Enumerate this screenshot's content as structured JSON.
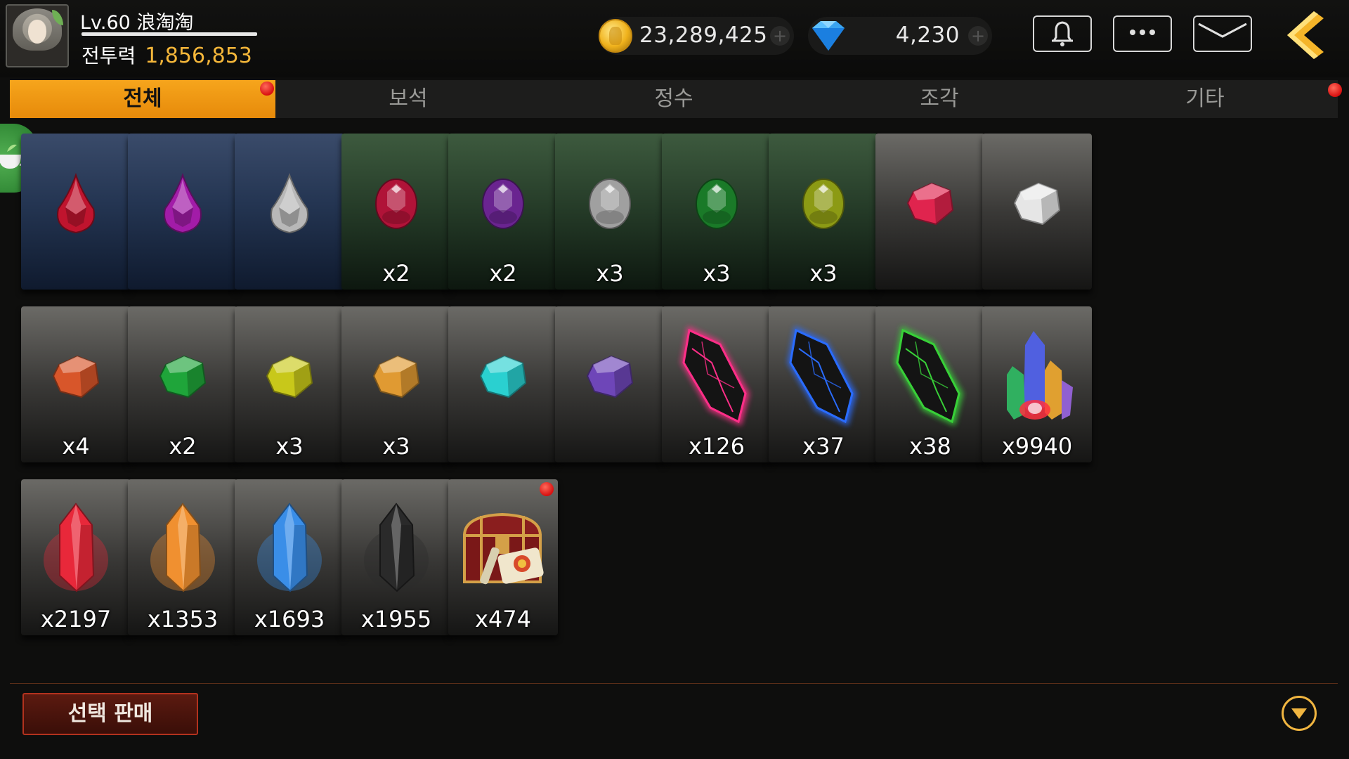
{
  "player": {
    "level_name": "Lv.60 浪淘淘",
    "power_label": "전투력",
    "power_value": "1,856,853"
  },
  "currency": {
    "gold": "23,289,425",
    "gems": "4,230"
  },
  "tabs": [
    {
      "label": "전체",
      "active": true,
      "has_badge": true
    },
    {
      "label": "보석",
      "active": false,
      "has_badge": false
    },
    {
      "label": "정수",
      "active": false,
      "has_badge": false
    },
    {
      "label": "조각",
      "active": false,
      "has_badge": false
    },
    {
      "label": "기타",
      "active": false,
      "has_badge": true
    }
  ],
  "items": [
    {
      "icon": "ruby-drop-gem-icon",
      "bg": "blue",
      "color": "#c0142e",
      "shape": "drop",
      "qty": ""
    },
    {
      "icon": "amethyst-drop-gem-icon",
      "bg": "blue",
      "color": "#a21ca8",
      "shape": "drop",
      "qty": ""
    },
    {
      "icon": "diamond-drop-gem-icon",
      "bg": "blue",
      "color": "#b8b8b8",
      "shape": "drop",
      "qty": ""
    },
    {
      "icon": "ruby-oval-gem-icon",
      "bg": "green",
      "color": "#b01338",
      "shape": "oval",
      "qty": "x2"
    },
    {
      "icon": "amethyst-oval-gem-icon",
      "bg": "green",
      "color": "#6a2490",
      "shape": "oval",
      "qty": "x2"
    },
    {
      "icon": "pearl-oval-gem-icon",
      "bg": "green",
      "color": "#a0a0a0",
      "shape": "oval",
      "qty": "x3"
    },
    {
      "icon": "emerald-oval-gem-icon",
      "bg": "green",
      "color": "#1a7a28",
      "shape": "oval",
      "qty": "x3"
    },
    {
      "icon": "peridot-oval-gem-icon",
      "bg": "green",
      "color": "#8c9a14",
      "shape": "oval",
      "qty": "x3"
    },
    {
      "icon": "pink-rough-gem-icon",
      "bg": "gray",
      "color": "#e0244e",
      "shape": "rough",
      "qty": ""
    },
    {
      "icon": "white-rough-gem-icon",
      "bg": "gray",
      "color": "#e6e6e6",
      "shape": "rough",
      "qty": ""
    },
    {
      "icon": "orange-rough-gem-icon",
      "bg": "gray",
      "color": "#d8562a",
      "shape": "rough",
      "qty": "x4"
    },
    {
      "icon": "green-rough-gem-icon",
      "bg": "gray",
      "color": "#1fa53a",
      "shape": "rough",
      "qty": "x2"
    },
    {
      "icon": "yellow-rough-gem-icon",
      "bg": "gray",
      "color": "#c8c81a",
      "shape": "rough",
      "qty": "x3"
    },
    {
      "icon": "amber-rough-gem-icon",
      "bg": "gray",
      "color": "#e09a32",
      "shape": "rough",
      "qty": "x3"
    },
    {
      "icon": "cyan-rough-gem-icon",
      "bg": "gray",
      "color": "#2ad0d0",
      "shape": "rough",
      "qty": ""
    },
    {
      "icon": "violet-rough-gem-icon",
      "bg": "gray",
      "color": "#6e46b8",
      "shape": "rough",
      "qty": ""
    },
    {
      "icon": "pink-glow-shard-icon",
      "bg": "gray",
      "color": "#ff2e88",
      "shape": "shard",
      "qty": "x126"
    },
    {
      "icon": "blue-glow-shard-icon",
      "bg": "gray",
      "color": "#2a6cff",
      "shape": "shard",
      "qty": "x37"
    },
    {
      "icon": "green-glow-shard-icon",
      "bg": "gray",
      "color": "#38d038",
      "shape": "shard",
      "qty": "x38"
    },
    {
      "icon": "rainbow-crystal-cluster-icon",
      "bg": "gray",
      "color": "#ff4060",
      "shape": "cluster",
      "qty": "x9940"
    },
    {
      "icon": "red-essence-crystal-icon",
      "bg": "gray",
      "color": "#e8283a",
      "shape": "essence",
      "qty": "x2197"
    },
    {
      "icon": "orange-essence-crystal-icon",
      "bg": "gray",
      "color": "#f09030",
      "shape": "essence",
      "qty": "x1353"
    },
    {
      "icon": "blue-essence-crystal-icon",
      "bg": "gray",
      "color": "#3a8ee8",
      "shape": "essence",
      "qty": "x1693"
    },
    {
      "icon": "black-essence-crystal-icon",
      "bg": "gray",
      "color": "#2a2a2a",
      "shape": "essence",
      "qty": "x1955"
    },
    {
      "icon": "treasure-chest-scroll-icon",
      "bg": "gray",
      "color": "#8a1e1e",
      "shape": "chest",
      "qty": "x474",
      "has_badge": true
    }
  ],
  "bottom": {
    "sell_label": "선택 판매"
  }
}
